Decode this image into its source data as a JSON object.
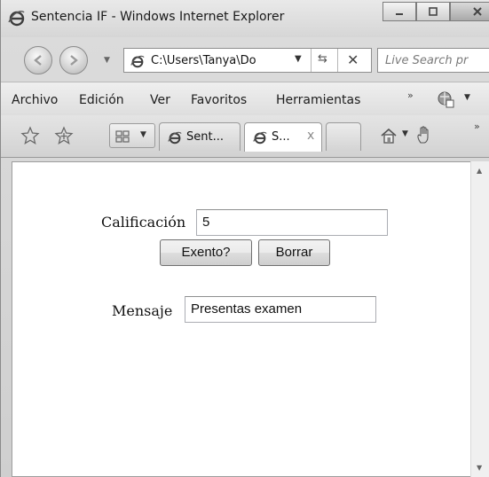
{
  "window": {
    "title": "Sentencia IF - Windows Internet Explorer"
  },
  "navigation": {
    "address": "C:\\Users\\Tanya\\Do",
    "search_placeholder": "Live Search pr"
  },
  "menu": {
    "items": [
      "Archivo",
      "Edición",
      "Ver",
      "Favoritos",
      "Herramientas"
    ],
    "more": "»"
  },
  "tabs": [
    {
      "label": "Sent...",
      "close": ""
    },
    {
      "label": "S...",
      "close": "x"
    }
  ],
  "form": {
    "calificacion_label": "Calificación",
    "calificacion_value": "5",
    "exento_button": "Exento?",
    "borrar_button": "Borrar",
    "mensaje_label": "Mensaje",
    "mensaje_value": "Presentas examen"
  },
  "icons": {
    "ie": "ie-logo-icon",
    "back": "back-arrow-icon",
    "forward": "forward-arrow-icon",
    "refresh": "refresh-icon",
    "stop": "stop-icon",
    "favorites": "star-icon",
    "add_favorites": "add-favorite-icon",
    "home": "home-icon",
    "research": "hand-icon"
  }
}
